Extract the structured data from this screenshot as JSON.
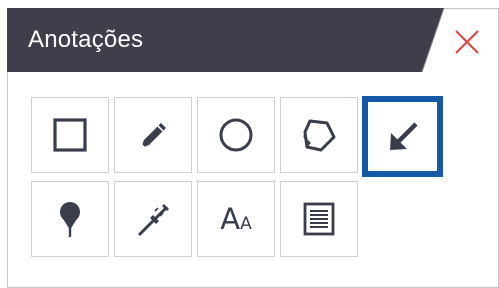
{
  "header": {
    "title": "Anotações"
  },
  "colors": {
    "header_bg": "#3f3f4c",
    "close_x": "#d64a4a",
    "icon": "#3a3d4c",
    "selected_border": "#1659a6"
  },
  "tools": [
    {
      "icon": "rectangle-icon"
    },
    {
      "icon": "pencil-icon"
    },
    {
      "icon": "circle-icon"
    },
    {
      "icon": "polygon-icon"
    },
    {
      "icon": "arrow-icon",
      "selected": true
    },
    {
      "icon": "map-pin-icon"
    },
    {
      "icon": "caliper-measure-icon"
    },
    {
      "icon": "text-icon",
      "text_big": "A",
      "text_small": "A"
    },
    {
      "icon": "note-icon"
    }
  ]
}
